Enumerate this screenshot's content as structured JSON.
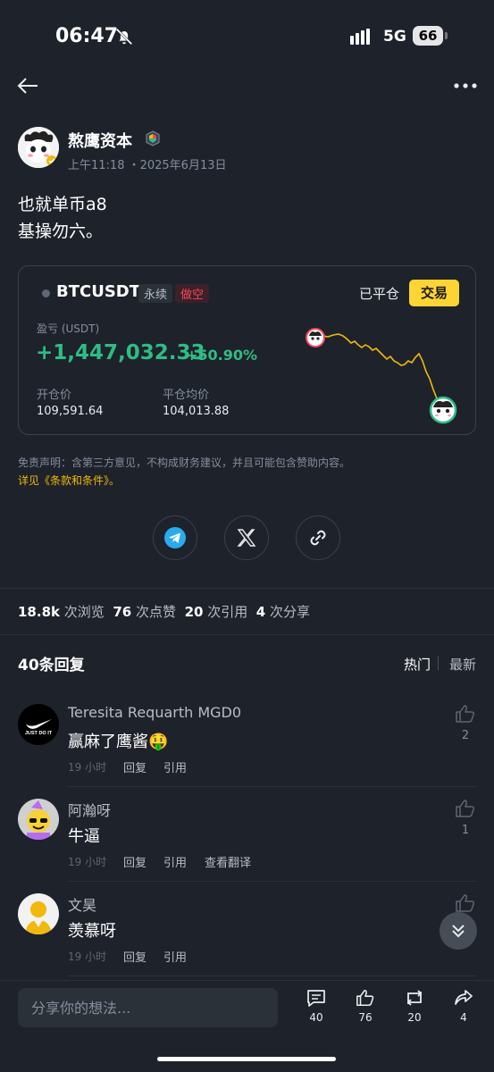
{
  "status_bar": {
    "time": "06:47",
    "network": "5G",
    "battery": "66"
  },
  "post": {
    "author": "熬鹰资本",
    "time": "上午11:18 ・2025年6月13日",
    "body_line1": "也就单币a8",
    "body_line2": "基操勿六。"
  },
  "trade_card": {
    "symbol": "BTCUSDT",
    "tag_perpetual": "永续",
    "tag_direction": "做空",
    "status": "已平仓",
    "trade_button": "交易",
    "pnl_label": "盈亏 (USDT)",
    "pnl_value": "+1,447,032.33",
    "pnl_percent": "+50.90%",
    "open_label": "开仓价",
    "open_value": "109,591.64",
    "close_label": "平仓均价",
    "close_value": "104,013.88",
    "colors": {
      "profit": "#2ebd85",
      "short": "#f6465d",
      "line": "#f0b90b"
    }
  },
  "disclaimer": {
    "text": "免责声明：含第三方意见，不构成财务建议，并且可能包含赞助内容。",
    "link": "详见《条款和条件》。"
  },
  "share": [
    "telegram-icon",
    "x-icon",
    "link-icon"
  ],
  "stats": {
    "views": "18.8k",
    "views_label": "次浏览",
    "likes": "76",
    "likes_label": "次点赞",
    "quotes": "20",
    "quotes_label": "次引用",
    "shares": "4",
    "shares_label": "次分享"
  },
  "replies": {
    "title": "40条回复",
    "sort_hot": "热门",
    "sort_new": "最新",
    "items": [
      {
        "name": "Teresita Requarth MGD0",
        "text": "赢麻了鹰酱🤑",
        "time": "19 小时",
        "reply": "回复",
        "quote": "引用",
        "likes": "2",
        "avatar_text": "JUST DO IT"
      },
      {
        "name": "阿瀚呀",
        "text": "牛逼",
        "time": "19 小时",
        "reply": "回复",
        "quote": "引用",
        "translate": "查看翻译",
        "likes": "1"
      },
      {
        "name": "文昊",
        "text": "羡慕呀",
        "time": "19 小时",
        "reply": "回复",
        "quote": "引用"
      }
    ]
  },
  "bottom_bar": {
    "placeholder": "分享你的想法...",
    "comments": "40",
    "likes": "76",
    "reposts": "20",
    "shares": "4"
  }
}
